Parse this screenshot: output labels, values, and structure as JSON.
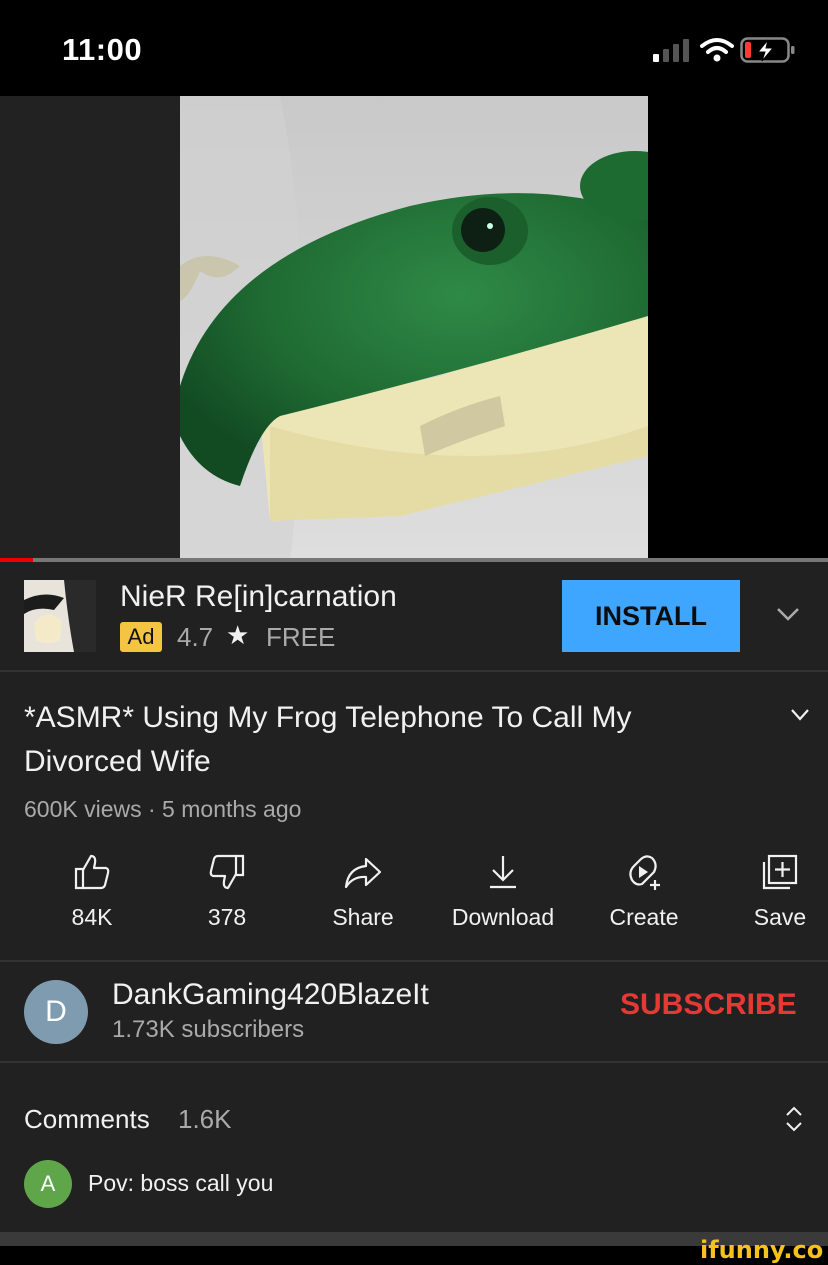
{
  "status_bar": {
    "time": "11:00"
  },
  "video": {
    "progress_fraction": 0.04
  },
  "ad": {
    "title": "NieR Re[in]carnation",
    "badge": "Ad",
    "rating": "4.7",
    "star": "★",
    "price": "FREE",
    "install_label": "INSTALL"
  },
  "video_info": {
    "title": "*ASMR* Using My Frog Telephone To Call My Divorced Wife",
    "views": "600K views · 5 months ago"
  },
  "actions": [
    {
      "label": "84K",
      "icon": "thumbs-up-icon"
    },
    {
      "label": "378",
      "icon": "thumbs-down-icon"
    },
    {
      "label": "Share",
      "icon": "share-icon"
    },
    {
      "label": "Download",
      "icon": "download-icon"
    },
    {
      "label": "Create",
      "icon": "create-icon"
    },
    {
      "label": "Save",
      "icon": "save-playlist-icon"
    }
  ],
  "channel": {
    "avatar_letter": "D",
    "name": "DankGaming420BlazeIt",
    "subscribers": "1.73K subscribers",
    "subscribe_label": "SUBSCRIBE"
  },
  "comments": {
    "label": "Comments",
    "count": "1.6K",
    "top_comment": {
      "avatar_letter": "A",
      "text": "Pov: boss call you"
    }
  },
  "watermark": "ifunny.co",
  "colors": {
    "accent_blue": "#3ea6ff",
    "subscribe_red": "#e53935",
    "ad_badge": "#f4c542",
    "progress_red": "#ee0000"
  }
}
